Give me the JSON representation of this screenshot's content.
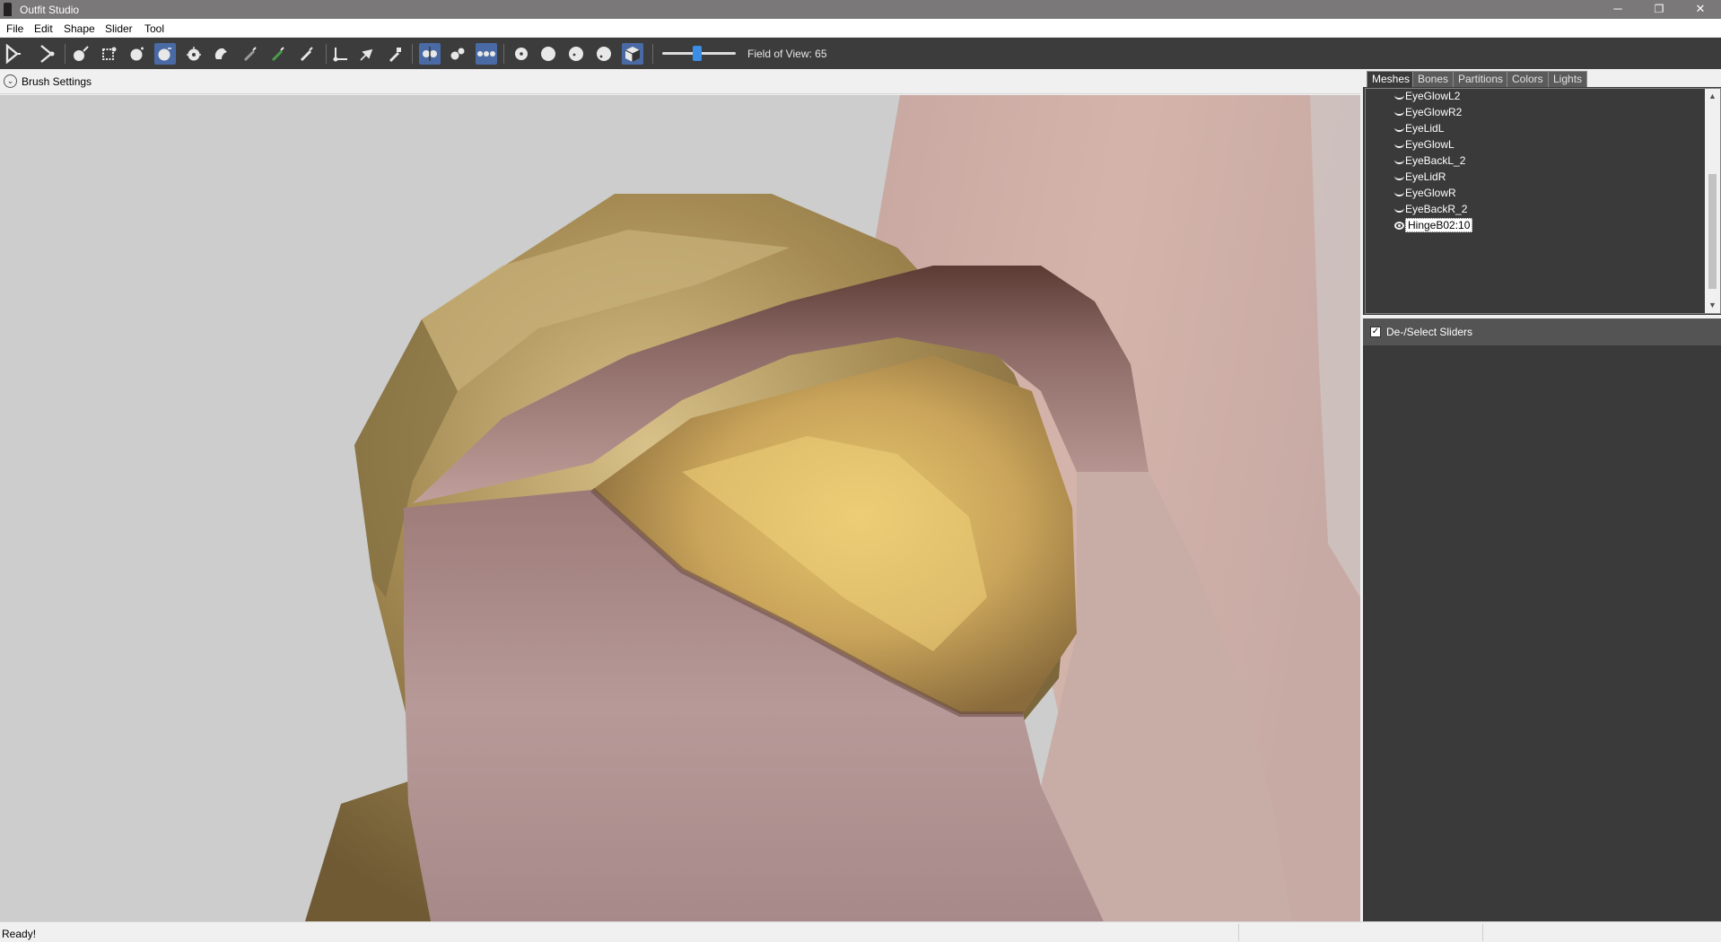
{
  "window": {
    "title": "Outfit Studio",
    "minimize": "─",
    "restore": "❐",
    "close": "✕"
  },
  "menu": [
    "File",
    "Edit",
    "Shape",
    "Slider",
    "Tool"
  ],
  "toolbar": {
    "fov_label": "Field of View: 65",
    "fov_value": 65
  },
  "brush": {
    "toggle_glyph": "⌄",
    "label": "Brush Settings"
  },
  "tabs": [
    {
      "label": "Meshes",
      "active": true
    },
    {
      "label": "Bones",
      "active": false
    },
    {
      "label": "Partitions",
      "active": false
    },
    {
      "label": "Colors",
      "active": false
    },
    {
      "label": "Lights",
      "active": false
    }
  ],
  "meshes": [
    {
      "name": "EyeGlowL2",
      "visible": false,
      "selected": false
    },
    {
      "name": "EyeGlowR2",
      "visible": false,
      "selected": false
    },
    {
      "name": "EyeLidL",
      "visible": false,
      "selected": false
    },
    {
      "name": "EyeGlowL",
      "visible": false,
      "selected": false
    },
    {
      "name": "EyeBackL_2",
      "visible": false,
      "selected": false
    },
    {
      "name": "EyeLidR",
      "visible": false,
      "selected": false
    },
    {
      "name": "EyeGlowR",
      "visible": false,
      "selected": false
    },
    {
      "name": "EyeBackR_2",
      "visible": false,
      "selected": false
    },
    {
      "name": "HingeB02:10",
      "visible": true,
      "selected": true
    }
  ],
  "sliders": {
    "checkbox_glyph": "✓",
    "label": "De-/Select Sliders"
  },
  "status": {
    "text": "Ready!"
  },
  "colors": {
    "toolbar_bg": "#3c3c3c",
    "panel_bg": "#3a3a3a",
    "accent": "#3a8ee6",
    "titlebar": "#7a7878"
  }
}
